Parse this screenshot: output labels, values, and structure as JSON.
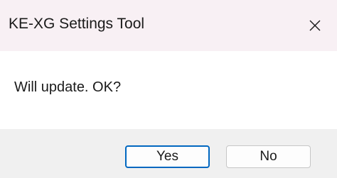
{
  "window": {
    "title": "KE-XG Settings Tool",
    "close_icon": "close-icon"
  },
  "content": {
    "message": "Will update. OK?"
  },
  "buttons": {
    "yes_label": "Yes",
    "no_label": "No",
    "default": "yes"
  },
  "colors": {
    "titlebar_bg": "#f8f0f4",
    "footer_bg": "#f0f0f0",
    "accent": "#0067c0"
  }
}
